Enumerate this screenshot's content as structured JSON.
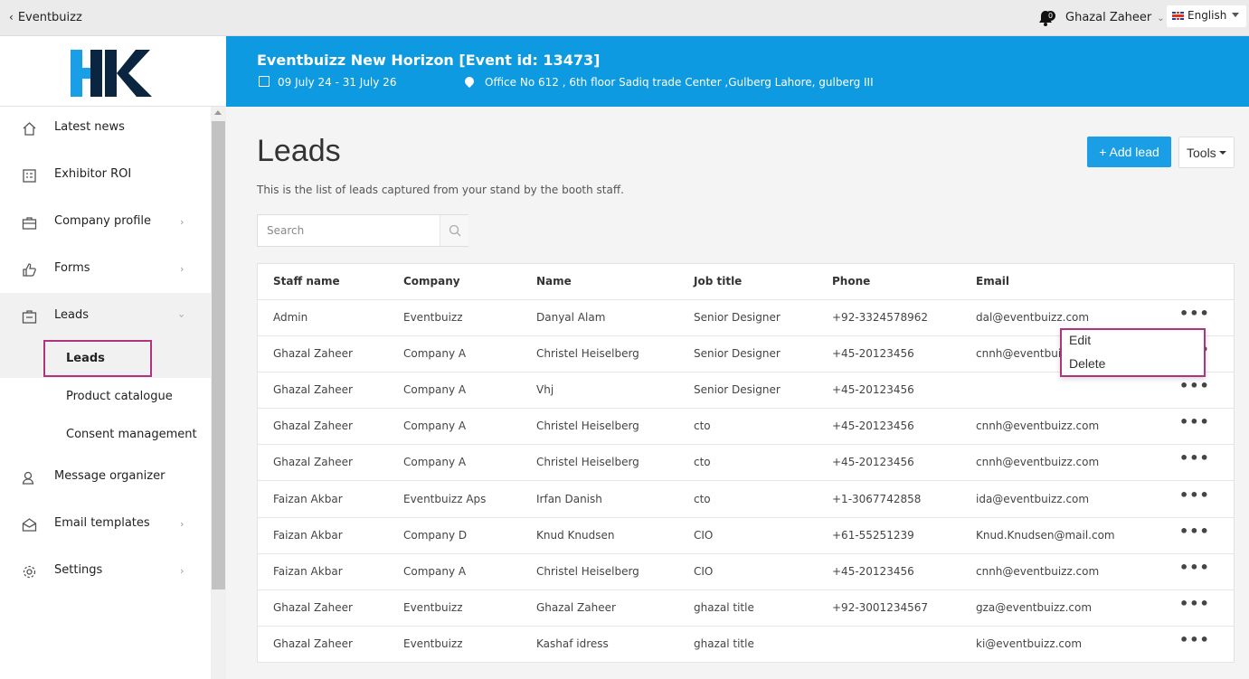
{
  "topbar": {
    "back_label": "Eventbuizz",
    "notification_count": "0",
    "user_name": "Ghazal Zaheer",
    "language": "English"
  },
  "event": {
    "title": "Eventbuizz New Horizon [Event id: 13473]",
    "dates": "09 July 24 - 31 July 26",
    "location": "Office No 612 , 6th floor Sadiq trade Center ,Gulberg Lahore, gulberg III"
  },
  "sidebar": {
    "logo_text": "HK",
    "items": [
      {
        "label": "Latest news",
        "icon": "home-icon",
        "has_arrow": false
      },
      {
        "label": "Exhibitor ROI",
        "icon": "checklist-icon",
        "has_arrow": false
      },
      {
        "label": "Company profile",
        "icon": "briefcase-icon",
        "has_arrow": true
      },
      {
        "label": "Forms",
        "icon": "thumbs-up-icon",
        "has_arrow": true
      },
      {
        "label": "Leads",
        "icon": "id-card-icon",
        "has_arrow": true,
        "expanded": true
      },
      {
        "label": "Message organizer",
        "icon": "user-chat-icon",
        "has_arrow": false
      },
      {
        "label": "Email templates",
        "icon": "envelope-open-icon",
        "has_arrow": true
      },
      {
        "label": "Settings",
        "icon": "gear-icon",
        "has_arrow": true
      }
    ],
    "sub_items": [
      {
        "label": "Leads",
        "active": true
      },
      {
        "label": "Product catalogue",
        "active": false
      },
      {
        "label": "Consent management",
        "active": false
      }
    ]
  },
  "main": {
    "title": "Leads",
    "subtitle": "This is the list of leads captured from your stand by the booth staff.",
    "add_button": "+ Add lead",
    "tools_button": "Tools",
    "search_placeholder": "Search"
  },
  "table": {
    "columns": [
      "Staff name",
      "Company",
      "Name",
      "Job title",
      "Phone",
      "Email"
    ],
    "rows": [
      [
        "Admin",
        "Eventbuizz",
        "Danyal Alam",
        "Senior Designer",
        "+92-3324578962",
        "dal@eventbuizz.com"
      ],
      [
        "Ghazal Zaheer",
        "Company A",
        "Christel Heiselberg",
        "Senior Designer",
        "+45-20123456",
        "cnnh@eventbuizz.com"
      ],
      [
        "Ghazal Zaheer",
        "Company A",
        "Vhj",
        "Senior Designer",
        "+45-20123456",
        ""
      ],
      [
        "Ghazal Zaheer",
        "Company A",
        "Christel Heiselberg",
        "cto",
        "+45-20123456",
        "cnnh@eventbuizz.com"
      ],
      [
        "Ghazal Zaheer",
        "Company A",
        "Christel Heiselberg",
        "cto",
        "+45-20123456",
        "cnnh@eventbuizz.com"
      ],
      [
        "Faizan Akbar",
        "Eventbuizz Aps",
        "Irfan Danish",
        "cto",
        "+1-3067742858",
        "ida@eventbuizz.com"
      ],
      [
        "Faizan Akbar",
        "Company D",
        "Knud Knudsen",
        "CIO",
        "+61-55251239",
        "Knud.Knudsen@mail.com"
      ],
      [
        "Faizan Akbar",
        "Company A",
        "Christel Heiselberg",
        "CIO",
        "+45-20123456",
        "cnnh@eventbuizz.com"
      ],
      [
        "Ghazal Zaheer",
        "Eventbuizz",
        "Ghazal Zaheer",
        "ghazal title",
        "+92-3001234567",
        "gza@eventbuizz.com"
      ],
      [
        "Ghazal Zaheer",
        "Eventbuizz",
        "Kashaf idress",
        "ghazal title",
        "",
        "ki@eventbuizz.com"
      ]
    ],
    "row_menu": [
      "Edit",
      "Delete"
    ]
  },
  "colors": {
    "accent": "#0d9ae0",
    "button": "#1a9ee5",
    "highlight": "#b0337e"
  }
}
